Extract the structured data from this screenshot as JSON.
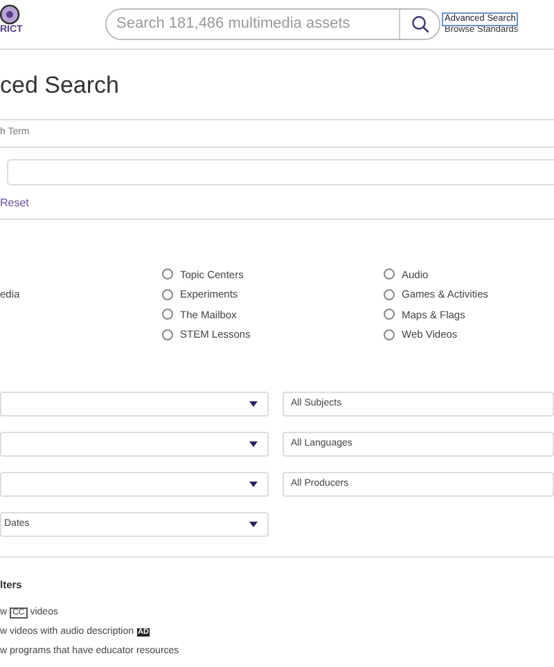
{
  "header": {
    "logo_text": "RICT",
    "search": {
      "placeholder": "Search 181,486 multimedia assets"
    },
    "links": [
      {
        "label": "Advanced Search",
        "selected": true
      },
      {
        "label": "Browse Standards",
        "selected": false
      }
    ]
  },
  "title": "ced Search",
  "search_term": {
    "label": "h Term",
    "reset": "Reset"
  },
  "media_types": [
    {
      "items": [
        {
          "kind": "blank"
        },
        {
          "kind": "cut",
          "label": "edia"
        }
      ]
    },
    {
      "items": [
        {
          "kind": "radio",
          "label": "Topic Centers",
          "checked": false
        },
        {
          "kind": "radio",
          "label": "Experiments",
          "checked": false
        },
        {
          "kind": "radio",
          "label": "The Mailbox",
          "checked": false
        },
        {
          "kind": "radio",
          "label": "STEM Lessons",
          "checked": false
        }
      ]
    },
    {
      "items": [
        {
          "kind": "radio",
          "label": "Audio",
          "checked": false
        },
        {
          "kind": "radio",
          "label": "Games & Activities",
          "checked": false
        },
        {
          "kind": "radio",
          "label": "Maps & Flags",
          "checked": false
        },
        {
          "kind": "radio",
          "label": "Web Videos",
          "checked": false
        }
      ]
    }
  ],
  "dropdown_rows": [
    {
      "left": {
        "kind": "select"
      },
      "right": {
        "kind": "field",
        "value": "All Subjects"
      }
    },
    {
      "left": {
        "kind": "select"
      },
      "right": {
        "kind": "field",
        "value": "All Languages"
      }
    },
    {
      "left": {
        "kind": "select"
      },
      "right": {
        "kind": "field",
        "value": "All Producers"
      }
    },
    {
      "left": {
        "kind": "select",
        "value": "Dates"
      }
    }
  ],
  "filters": {
    "title": "lters",
    "items": [
      {
        "parts": [
          {
            "kind": "text",
            "text": "w"
          },
          {
            "kind": "cc",
            "text": "CC"
          },
          {
            "kind": "text",
            "text": "videos"
          }
        ]
      },
      {
        "parts": [
          {
            "kind": "text",
            "text": "w videos with audio description"
          },
          {
            "kind": "ad",
            "text": "AD"
          }
        ]
      },
      {
        "parts": [
          {
            "kind": "text",
            "text": "w programs that have educator resources"
          }
        ]
      }
    ]
  }
}
